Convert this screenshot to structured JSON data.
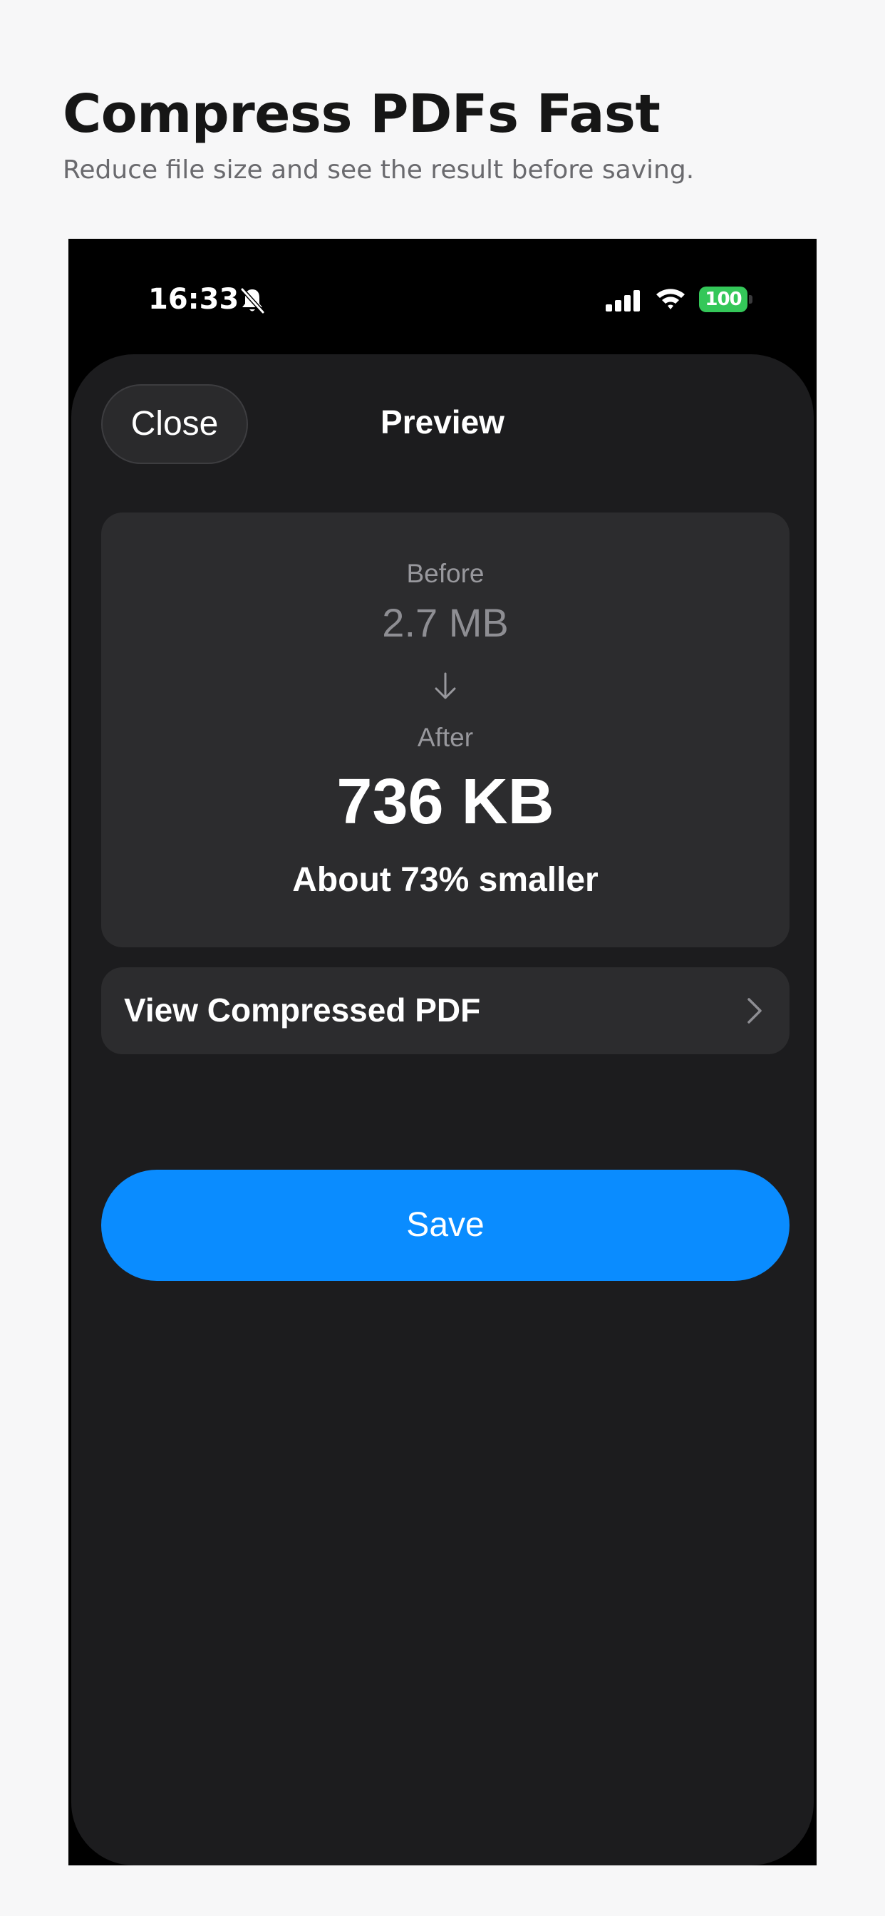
{
  "header": {
    "title": "Compress PDFs Fast",
    "subtitle": "Reduce file size and see the result before saving."
  },
  "status_bar": {
    "time": "16:33",
    "silent_icon": "bell-slash-icon",
    "signal_icon": "cellular-signal-icon",
    "wifi_icon": "wifi-icon",
    "battery_level": "100",
    "battery_color": "#34c759"
  },
  "sheet": {
    "close_label": "Close",
    "title": "Preview"
  },
  "size_card": {
    "before_label": "Before",
    "before_value": "2.7 MB",
    "arrow_icon": "arrow-down-icon",
    "after_label": "After",
    "after_value": "736 KB",
    "reduction_text": "About 73% smaller"
  },
  "view_pdf": {
    "label": "View Compressed PDF",
    "icon": "chevron-right-icon"
  },
  "actions": {
    "save_label": "Save",
    "accent_color": "#0a8cff"
  }
}
